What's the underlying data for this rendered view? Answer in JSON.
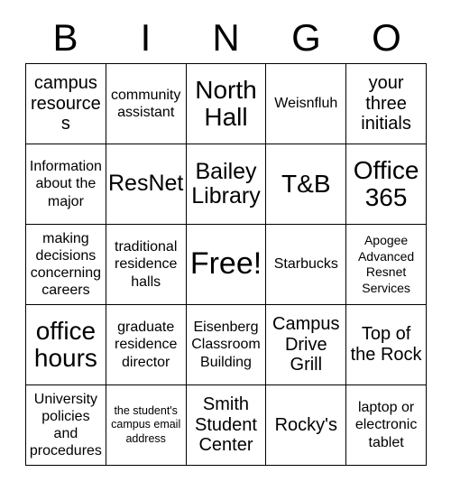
{
  "card": {
    "title": "BINGO",
    "header_letters": [
      "B",
      "I",
      "N",
      "G",
      "O"
    ],
    "columns": 5,
    "rows": 5,
    "border_color": "#000000",
    "background_color": "#ffffff",
    "text_color": "#000000"
  },
  "cells": [
    {
      "row": 1,
      "col": 1,
      "column_letter": "B",
      "text": "campus resources",
      "size": "md",
      "free_space": false
    },
    {
      "row": 1,
      "col": 2,
      "column_letter": "I",
      "text": "community assistant",
      "size": "sm",
      "free_space": false
    },
    {
      "row": 1,
      "col": 3,
      "column_letter": "N",
      "text": "North Hall",
      "size": "xl",
      "free_space": false
    },
    {
      "row": 1,
      "col": 4,
      "column_letter": "G",
      "text": "Weisnfluh",
      "size": "sm",
      "free_space": false
    },
    {
      "row": 1,
      "col": 5,
      "column_letter": "O",
      "text": "your three initials",
      "size": "md",
      "free_space": false
    },
    {
      "row": 2,
      "col": 1,
      "column_letter": "B",
      "text": "Information about the major",
      "size": "sm",
      "free_space": false
    },
    {
      "row": 2,
      "col": 2,
      "column_letter": "I",
      "text": "ResNet",
      "size": "lg",
      "free_space": false
    },
    {
      "row": 2,
      "col": 3,
      "column_letter": "N",
      "text": "Bailey Library",
      "size": "lg",
      "free_space": false
    },
    {
      "row": 2,
      "col": 4,
      "column_letter": "G",
      "text": "T&B",
      "size": "xl",
      "free_space": false
    },
    {
      "row": 2,
      "col": 5,
      "column_letter": "O",
      "text": "Office 365",
      "size": "xl",
      "free_space": false
    },
    {
      "row": 3,
      "col": 1,
      "column_letter": "B",
      "text": "making decisions concerning careers",
      "size": "sm",
      "free_space": false
    },
    {
      "row": 3,
      "col": 2,
      "column_letter": "I",
      "text": "traditional residence halls",
      "size": "sm",
      "free_space": false
    },
    {
      "row": 3,
      "col": 3,
      "column_letter": "N",
      "text": "Free!",
      "size": "xxl",
      "free_space": true
    },
    {
      "row": 3,
      "col": 4,
      "column_letter": "G",
      "text": "Starbucks",
      "size": "sm",
      "free_space": false
    },
    {
      "row": 3,
      "col": 5,
      "column_letter": "O",
      "text": "Apogee Advanced Resnet Services",
      "size": "xs",
      "free_space": false
    },
    {
      "row": 4,
      "col": 1,
      "column_letter": "B",
      "text": "office hours",
      "size": "xl",
      "free_space": false
    },
    {
      "row": 4,
      "col": 2,
      "column_letter": "I",
      "text": "graduate residence director",
      "size": "sm",
      "free_space": false
    },
    {
      "row": 4,
      "col": 3,
      "column_letter": "N",
      "text": "Eisenberg Classroom Building",
      "size": "sm",
      "free_space": false
    },
    {
      "row": 4,
      "col": 4,
      "column_letter": "G",
      "text": "Campus Drive Grill",
      "size": "md",
      "free_space": false
    },
    {
      "row": 4,
      "col": 5,
      "column_letter": "O",
      "text": "Top of the Rock",
      "size": "md",
      "free_space": false
    },
    {
      "row": 5,
      "col": 1,
      "column_letter": "B",
      "text": "University policies and procedures",
      "size": "sm",
      "free_space": false
    },
    {
      "row": 5,
      "col": 2,
      "column_letter": "I",
      "text": "the student's campus email address",
      "size": "xxs",
      "free_space": false
    },
    {
      "row": 5,
      "col": 3,
      "column_letter": "N",
      "text": "Smith Student Center",
      "size": "md",
      "free_space": false
    },
    {
      "row": 5,
      "col": 4,
      "column_letter": "G",
      "text": "Rocky's",
      "size": "md",
      "free_space": false
    },
    {
      "row": 5,
      "col": 5,
      "column_letter": "O",
      "text": "laptop or electronic tablet",
      "size": "sm",
      "free_space": false
    }
  ]
}
